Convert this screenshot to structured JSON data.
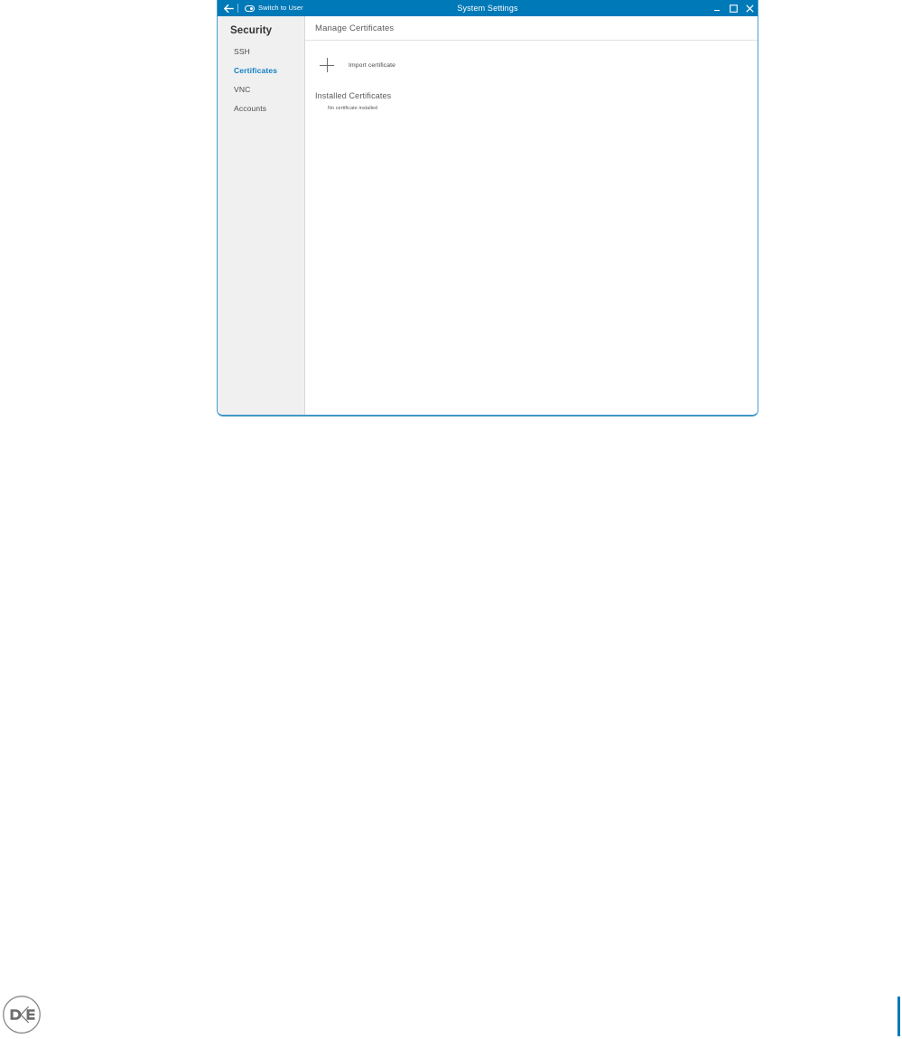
{
  "window": {
    "title": "System Settings",
    "titlebar": {
      "back_icon": "arrow-left-icon",
      "switch_user_label": "Switch to User",
      "switch_user_icon": "switch-user-icon",
      "minimize_label": "_",
      "maximize_icon": "maximize-icon",
      "close_icon": "close-icon"
    },
    "accent_color": "#0079b8",
    "border_color": "#4a9ccc"
  },
  "sidebar": {
    "title": "Security",
    "background_color": "#f0f0f0",
    "active_color": "#0f7fc4",
    "items": [
      {
        "label": "SSH",
        "active": false
      },
      {
        "label": "Certificates",
        "active": true
      },
      {
        "label": "VNC",
        "active": false
      },
      {
        "label": "Accounts",
        "active": false
      }
    ]
  },
  "main": {
    "header_title": "Manage Certificates",
    "import_action": {
      "icon": "plus-icon",
      "label": "Import certificate"
    },
    "installed_section": {
      "title": "Installed Certificates",
      "empty_message": "No certificate installed"
    }
  },
  "desktop": {
    "logo": "dell-logo",
    "logo_text": "DELL"
  }
}
